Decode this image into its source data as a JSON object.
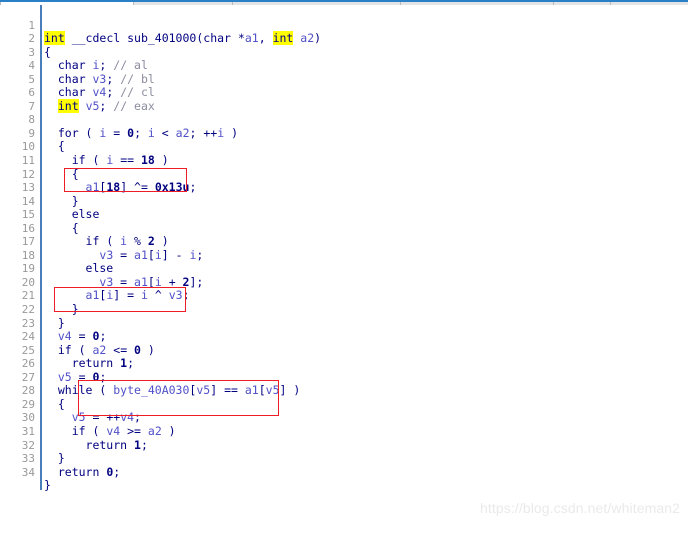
{
  "window": {
    "topbar": {
      "visible": true,
      "background": "#e4e4e4",
      "accent": "#2a7fc9"
    }
  },
  "editor": {
    "type": "decompiler-pseudocode",
    "background": "#ffffff",
    "gutter_rule_color": "#4a7ebb",
    "line_number_color": "#999999",
    "highlight_color": "#ffff00",
    "keyword_color": "#000080",
    "variable_color": "#5050c8",
    "comment_color": "#8c8ca0",
    "annotation_color": "#ee1c25",
    "line_count": 34,
    "lines": [
      {
        "n": "1",
        "text": "int __cdecl sub_401000(char *a1, int a2)"
      },
      {
        "n": "2",
        "text": "{"
      },
      {
        "n": "3",
        "text": "  char i; // al"
      },
      {
        "n": "4",
        "text": "  char v3; // bl"
      },
      {
        "n": "5",
        "text": "  char v4; // cl"
      },
      {
        "n": "6",
        "text": "  int v5; // eax"
      },
      {
        "n": "7",
        "text": ""
      },
      {
        "n": "8",
        "text": "  for ( i = 0; i < a2; ++i )"
      },
      {
        "n": "9",
        "text": "  {"
      },
      {
        "n": "10",
        "text": "    if ( i == 18 )"
      },
      {
        "n": "11",
        "text": "    {"
      },
      {
        "n": "12",
        "text": "      a1[18] ^= 0x13u;"
      },
      {
        "n": "13",
        "text": "    }"
      },
      {
        "n": "14",
        "text": "    else"
      },
      {
        "n": "15",
        "text": "    {"
      },
      {
        "n": "16",
        "text": "      if ( i % 2 )"
      },
      {
        "n": "17",
        "text": "        v3 = a1[i] - i;"
      },
      {
        "n": "18",
        "text": "      else"
      },
      {
        "n": "19",
        "text": "        v3 = a1[i + 2];"
      },
      {
        "n": "20",
        "text": "      a1[i] = i ^ v3;"
      },
      {
        "n": "21",
        "text": "    }"
      },
      {
        "n": "22",
        "text": "  }"
      },
      {
        "n": "23",
        "text": "  v4 = 0;"
      },
      {
        "n": "24",
        "text": "  if ( a2 <= 0 )"
      },
      {
        "n": "25",
        "text": "    return 1;"
      },
      {
        "n": "26",
        "text": "  v5 = 0;"
      },
      {
        "n": "27",
        "text": "  while ( byte_40A030[v5] == a1[v5] )"
      },
      {
        "n": "28",
        "text": "  {"
      },
      {
        "n": "29",
        "text": "    v5 = ++v4;"
      },
      {
        "n": "30",
        "text": "    if ( v4 >= a2 )"
      },
      {
        "n": "31",
        "text": "      return 1;"
      },
      {
        "n": "32",
        "text": "  }"
      },
      {
        "n": "33",
        "text": "  return 0;"
      },
      {
        "n": "34",
        "text": "}"
      }
    ],
    "highlighted_tokens": [
      "int"
    ],
    "annotations": [
      {
        "id": "box-xor-18",
        "target_line": "12",
        "content": "a1[18] ^= 0x13u;"
      },
      {
        "id": "box-xor-index",
        "target_line": "20",
        "content": "a1[i] = i ^ v3;"
      },
      {
        "id": "box-while-cond",
        "target_line": "27",
        "content": "( byte_40A030[v5] == a1[v5]"
      }
    ]
  },
  "watermark": {
    "text": "https://blog.csdn.net/whiteman2"
  }
}
